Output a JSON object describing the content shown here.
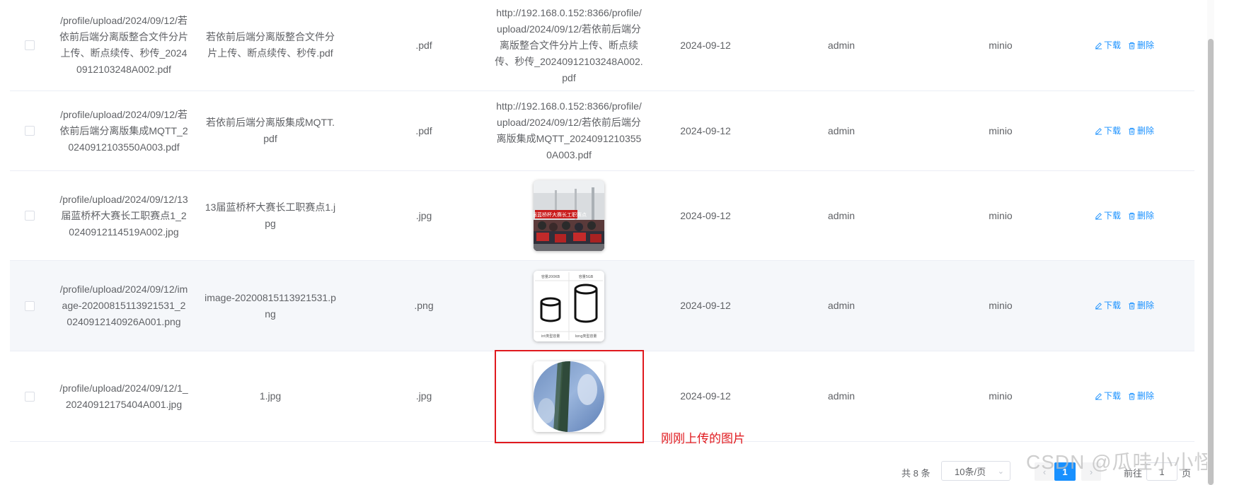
{
  "rows": [
    {
      "path": "/profile/upload/2024/09/12/若依前后端分离版整合文件分片上传、断点续传、秒传_20240912103248A002.pdf",
      "name": "若依前后端分离版整合文件分片上传、断点续传、秒传.pdf",
      "ext": ".pdf",
      "url": "http://192.168.0.152:8366/profile/upload/2024/09/12/若依前后端分离版整合文件分片上传、断点续传、秒传_20240912103248A002.pdf",
      "date": "2024-09-12",
      "user": "admin",
      "service": "minio"
    },
    {
      "path": "/profile/upload/2024/09/12/若依前后端分离版集成MQTT_20240912103550A003.pdf",
      "name": "若依前后端分离版集成MQTT.pdf",
      "ext": ".pdf",
      "url": "http://192.168.0.152:8366/profile/upload/2024/09/12/若依前后端分离版集成MQTT_20240912103550A003.pdf",
      "date": "2024-09-12",
      "user": "admin",
      "service": "minio"
    },
    {
      "path": "/profile/upload/2024/09/12/13届蓝桥杯大赛长工职赛点1_20240912114519A002.jpg",
      "name": "13届蓝桥杯大赛长工职赛点1.jpg",
      "ext": ".jpg",
      "url": "",
      "date": "2024-09-12",
      "user": "admin",
      "service": "minio"
    },
    {
      "path": "/profile/upload/2024/09/12/image-20200815113921531_20240912140926A001.png",
      "name": "image-20200815113921531.png",
      "ext": ".png",
      "url": "",
      "date": "2024-09-12",
      "user": "admin",
      "service": "minio"
    },
    {
      "path": "/profile/upload/2024/09/12/1_20240912175404A001.jpg",
      "name": "1.jpg",
      "ext": ".jpg",
      "url": "",
      "date": "2024-09-12",
      "user": "admin",
      "service": "minio"
    }
  ],
  "actions": {
    "download": "下载",
    "delete": "删除"
  },
  "thumb_text": {
    "banner": "13届蓝桥杯大赛长工职赛点",
    "cyl_left_top": "容量200KB",
    "cyl_right_top": "容量5GB",
    "cyl_left_bottom": "int类型容量",
    "cyl_right_bottom": "long类型容量"
  },
  "annotation": "刚刚上传的图片",
  "pagination": {
    "total": "共 8 条",
    "page_size": "10条/页",
    "current_page": "1",
    "goto_label": "前往",
    "goto_value": "1",
    "page_suffix": "页"
  },
  "watermark": "CSDN @瓜哇小小怪",
  "colors": {
    "link": "#1890ff",
    "annotation": "#e0191e",
    "row_hover": "#f5f7fa"
  }
}
